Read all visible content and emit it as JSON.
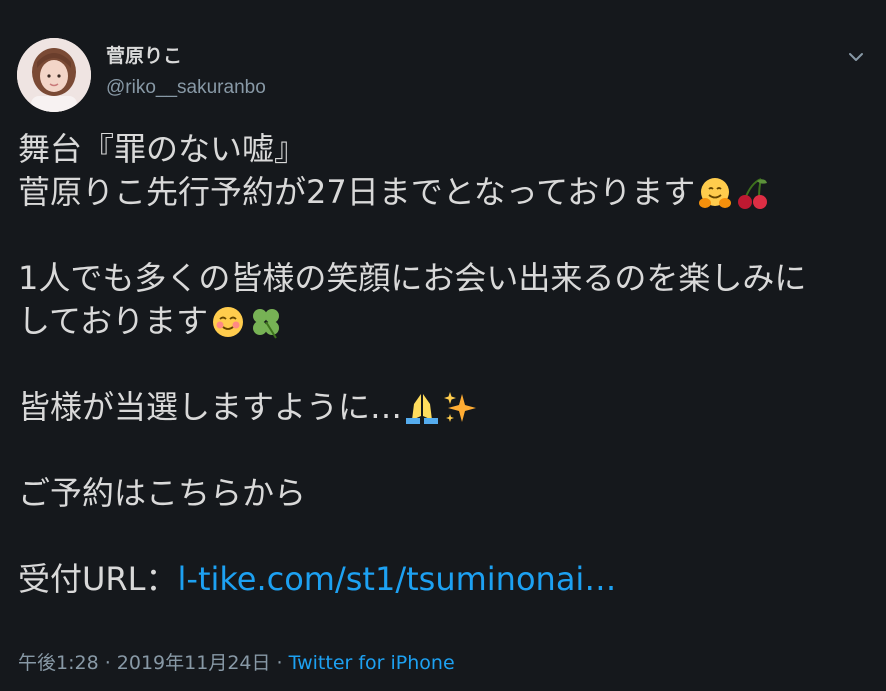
{
  "author": {
    "display_name": "菅原りこ",
    "handle": "@riko__sakuranbo"
  },
  "tweet": {
    "line1": "舞台『罪のない嘘』",
    "line2": "菅原りこ先行予約が27日までとなっております",
    "line3": "1人でも多くの皆様の笑顔にお会い出来るのを楽しみに",
    "line4": "しております",
    "line5": "皆様が当選しますように…",
    "line6": "ご予約はこちらから",
    "line7_prefix": "受付URL：",
    "line7_link": "l-tike.com/st1/tsuminonai…",
    "emoji": {
      "line2": [
        "hugging-face-emoji",
        "cherries-emoji"
      ],
      "line4": [
        "smiling-face-emoji",
        "four-leaf-clover-emoji"
      ],
      "line5": [
        "folded-hands-emoji",
        "sparkles-emoji"
      ]
    }
  },
  "meta": {
    "time": "午後1:28",
    "separator1": " · ",
    "date": "2019年11月24日",
    "separator2": " · ",
    "source": "Twitter for iPhone"
  },
  "colors": {
    "background": "#15181c",
    "text": "#d9d9d9",
    "muted": "#8899a6",
    "link": "#1da1f2"
  }
}
